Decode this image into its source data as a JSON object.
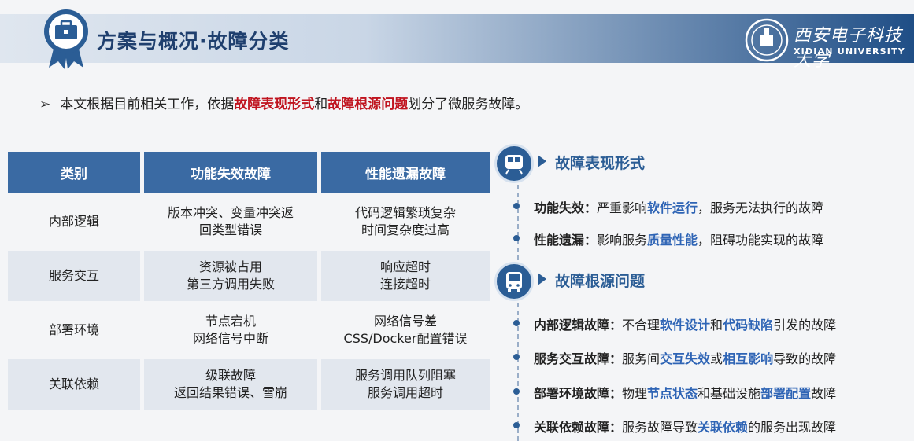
{
  "header": {
    "title": "方案与概况·故障分类",
    "university_cn": "西安电子科技大学",
    "university_en": "XIDIAN UNIVERSITY"
  },
  "intro": {
    "bullet": "➢",
    "p1": "本文根据目前相关工作，依据",
    "h1": "故障表现形式",
    "p2": "和",
    "h2": "故障根源问题",
    "p3": "划分了微服务故障。"
  },
  "table": {
    "headers": [
      "类别",
      "功能失效故障",
      "性能遗漏故障"
    ],
    "rows": [
      {
        "cat": "内部逻辑",
        "f1": "版本冲突、变量冲突返",
        "f2": "回类型错误",
        "p1": "代码逻辑繁琐复杂",
        "p2": "时间复杂度过高"
      },
      {
        "cat": "服务交互",
        "f1": "资源被占用",
        "f2": "第三方调用失败",
        "p1": "响应超时",
        "p2": "连接超时"
      },
      {
        "cat": "部署环境",
        "f1": "节点宕机",
        "f2": "网络信号中断",
        "p1": "网络信号差",
        "p2": "CSS/Docker配置错误"
      },
      {
        "cat": "关联依赖",
        "f1": "级联故障",
        "f2": "返回结果错误、雪崩",
        "p1": "服务调用队列阻塞",
        "p2": "服务调用超时"
      }
    ]
  },
  "sections": {
    "s1": {
      "title": "故障表现形式",
      "items": [
        {
          "label": "功能失效：",
          "a": "严重影响",
          "hl": "软件运行",
          "b": "，服务无法执行的故障"
        },
        {
          "label": "性能遗漏：",
          "a": "影响服务",
          "hl": "质量性能",
          "b": "，阻碍功能实现的故障"
        }
      ]
    },
    "s2": {
      "title": "故障根源问题",
      "items": [
        {
          "label": "内部逻辑故障：",
          "a": "不合理",
          "hl1": "软件设计",
          "b": "和",
          "hl2": "代码缺陷",
          "c": "引发的故障"
        },
        {
          "label": "服务交互故障：",
          "a": "服务间",
          "hl1": "交互失效",
          "b": "或",
          "hl2": "相互影响",
          "c": "导致的故障"
        },
        {
          "label": "部署环境故障：",
          "a": "物理",
          "hl1": "节点状态",
          "b": "和基础设施",
          "hl2": "部署配置",
          "c": "故障"
        },
        {
          "label": "关联依赖故障：",
          "a": "服务故障导致",
          "hl1": "关联依赖",
          "b": "的服务出现故障",
          "hl2": "",
          "c": ""
        }
      ]
    }
  },
  "icons": {
    "badge": "briefcase-ribbon-icon",
    "logo": "university-seal-icon",
    "s1_icon": "train-icon",
    "s2_icon": "bus-icon"
  },
  "colors": {
    "primary": "#2b5d95",
    "highlight_red": "#c0141f",
    "highlight_blue": "#2e64b5",
    "table_header": "#3a6aa3"
  }
}
